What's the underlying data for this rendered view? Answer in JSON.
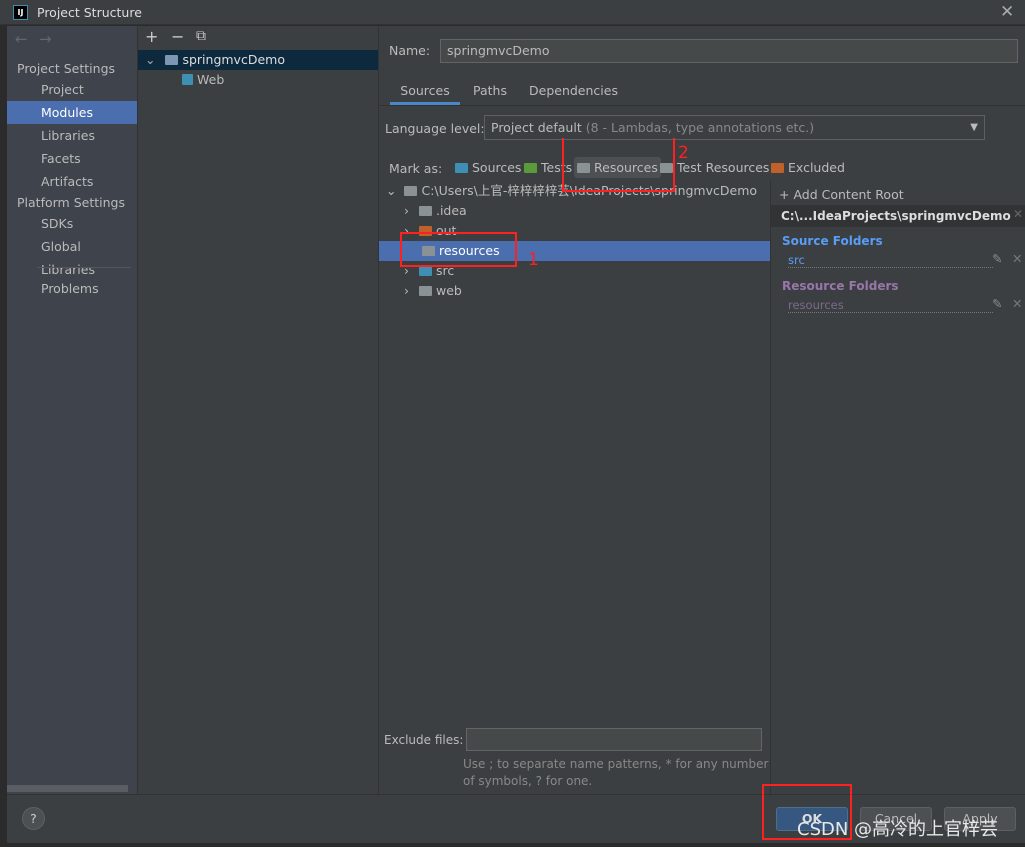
{
  "window": {
    "title": "Project Structure",
    "close_icon": "close-icon"
  },
  "sidebar": {
    "nav_back": "←",
    "nav_forward": "→",
    "project_settings": "Project Settings",
    "items1": [
      "Project",
      "Modules",
      "Libraries",
      "Facets",
      "Artifacts"
    ],
    "platform_settings": "Platform Settings",
    "items2": [
      "SDKs",
      "Global Libraries"
    ],
    "problems": "Problems"
  },
  "modules": {
    "toolbar": [
      "+",
      "−",
      "⧉"
    ],
    "tree": [
      {
        "label": "springmvcDemo"
      },
      {
        "label": "Web"
      }
    ]
  },
  "main": {
    "name_label": "Name:",
    "name_value": "springmvcDemo",
    "tabs": [
      "Sources",
      "Paths",
      "Dependencies"
    ],
    "language_label": "Language level:",
    "language_value": "Project default",
    "language_hint": "(8 - Lambdas, type annotations etc.)",
    "mark_as": "Mark as:",
    "marks": [
      {
        "label": "Sources",
        "color": "#3d8fb3"
      },
      {
        "label": "Tests",
        "color": "#5a9a3a"
      },
      {
        "label": "Resources",
        "color": "#8a9296"
      },
      {
        "label": "Test Resources",
        "color": "#8a9296"
      },
      {
        "label": "Excluded",
        "color": "#c0602a"
      }
    ],
    "tree": {
      "root": "C:\\Users\\上官-梓梓梓梓芸\\IdeaProjects\\springmvcDemo",
      "children": [
        {
          "label": ".idea",
          "color": "#8a9296"
        },
        {
          "label": "out",
          "color": "#c0602a"
        },
        {
          "label": "resources",
          "color": "#8a9296"
        },
        {
          "label": "src",
          "color": "#3d8fb3"
        },
        {
          "label": "web",
          "color": "#8a9296"
        }
      ]
    },
    "content_root": {
      "add": "+ Add Content Root",
      "path": "C:\\...IdeaProjects\\springmvcDemo",
      "source_title": "Source Folders",
      "source_items": [
        "src"
      ],
      "resource_title": "Resource Folders",
      "resource_items": [
        "resources"
      ]
    },
    "exclude_label": "Exclude files:",
    "exclude_value": "",
    "exclude_hint1": "Use ; to separate name patterns, * for any number",
    "exclude_hint2": "of symbols, ? for one."
  },
  "footer": {
    "help": "?",
    "ok": "OK",
    "cancel": "Cancel",
    "apply": "Apply"
  },
  "annotations": {
    "one": "1",
    "two": "2"
  },
  "watermark": "CSDN @高冷的上官梓芸"
}
